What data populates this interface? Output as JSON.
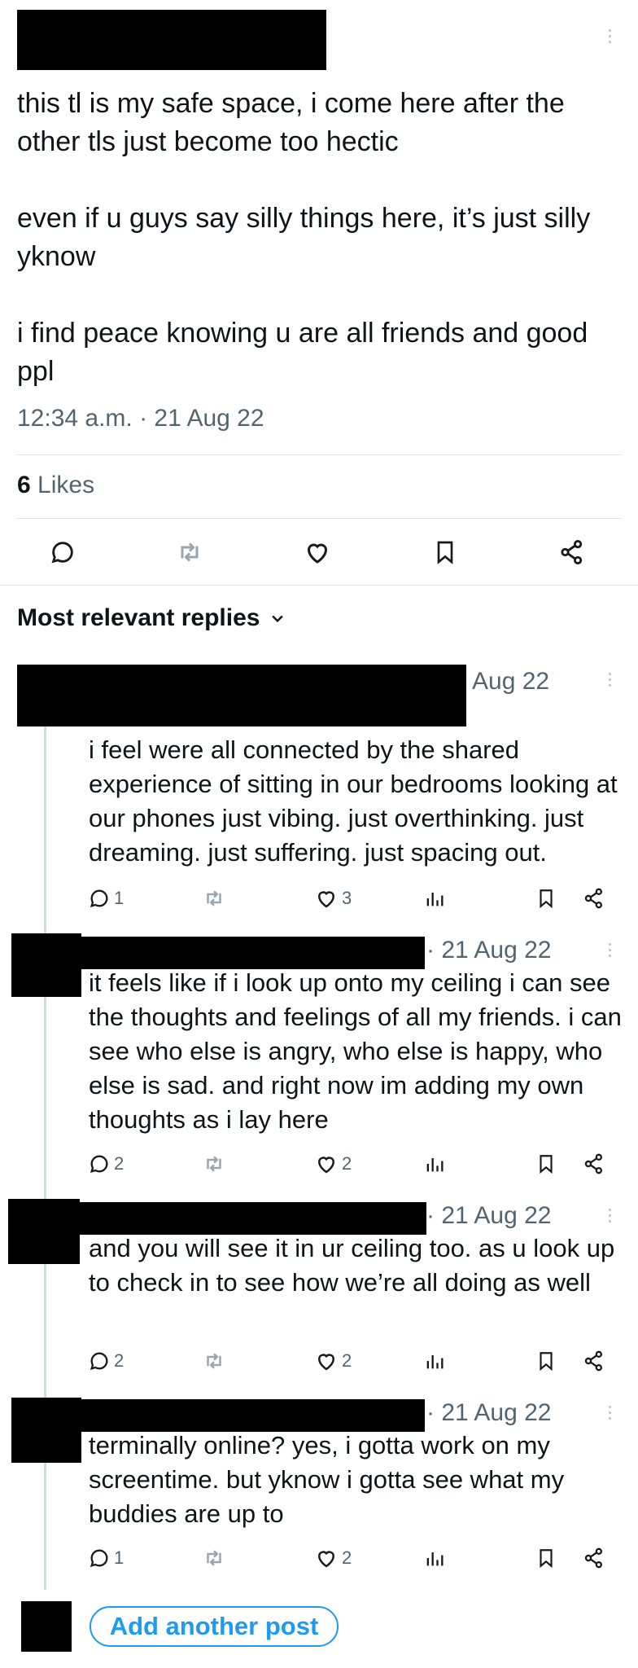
{
  "post": {
    "text": "this tl is my safe space, i come here after the other tls just become too hectic\n\neven if u guys say silly things here, it’s just silly yknow\n\ni find peace knowing u are all friends and good ppl",
    "timestamp": "12:34 a.m. · 21 Aug 22",
    "likes_count": "6",
    "likes_label": "Likes"
  },
  "action_icons": [
    "reply-icon",
    "retweet-icon",
    "like-icon",
    "bookmark-icon",
    "share-icon"
  ],
  "replies_header": {
    "label": "Most relevant replies",
    "icon": "chevron-down-icon"
  },
  "replies": [
    {
      "date": "Aug 22",
      "text": "i feel were all connected by the shared experience of sitting in our bedrooms looking at our phones just vibing. just overthinking. just dreaming. just suffering. just spacing out.",
      "replies": "1",
      "likes": "3"
    },
    {
      "date": "· 21 Aug 22",
      "text": "it feels like if i look up onto my ceiling i can see the thoughts and feelings of all my friends. i can see who else is angry, who else is happy, who else is sad. and right now im adding my own thoughts as i lay here",
      "replies": "2",
      "likes": "2"
    },
    {
      "date": "· 21 Aug 22",
      "text": "and you will see it in ur ceiling too. as u look up to check in to see how we’re all doing as well",
      "replies": "2",
      "likes": "2"
    },
    {
      "date": "· 21 Aug 22",
      "text": "terminally online? yes, i gotta work on my screentime. but yknow i gotta see what my buddies are up to",
      "replies": "1",
      "likes": "2"
    }
  ],
  "composer": {
    "button_label": "Add another post"
  },
  "colors": {
    "accent": "#1d9bf0",
    "secondary_text": "#536471",
    "icon": "#1a1a1a",
    "redaction": "#000000"
  }
}
